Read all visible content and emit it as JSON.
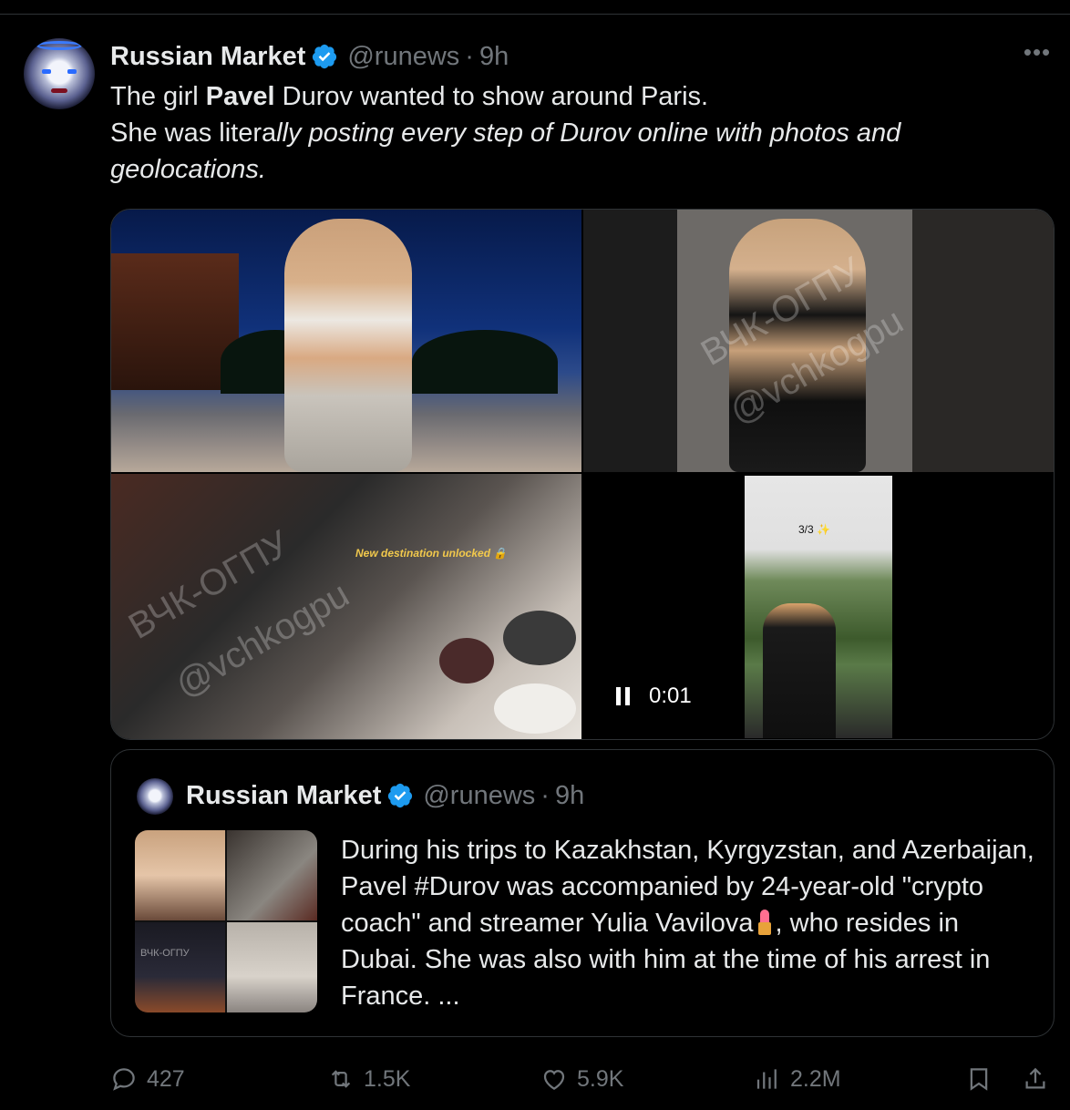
{
  "tweet": {
    "author_name": "Russian Market",
    "handle": "@runews",
    "time": "9h",
    "more_label": "•••",
    "text": {
      "line1_pre": "The girl ",
      "line1_bold": "Pavel",
      "line1_post": " Durov wanted to show around Paris.",
      "line2_plain": "She was litera",
      "line2_italic": "lly posting every step of Durov online with photos and",
      "line3_italic": "geolocations."
    },
    "media": {
      "overlay_text": "New destination unlocked 🔒",
      "story_counter": "3/3 ✨",
      "video_time": "0:01",
      "watermark_1": "ВЧК-ОГПУ",
      "watermark_2": "@vchkogpu"
    }
  },
  "quote": {
    "author_name": "Russian Market",
    "handle": "@runews",
    "time": "9h",
    "text_part1": "During his trips to Kazakhstan, Kyrgyzstan, and Azerbaijan, Pavel #Durov was accompanied by 24-year-old \"crypto coach\" and streamer Yulia Vavilova",
    "text_part2": ", who resides in Dubai. She was also with him at the time of his arrest in France. ...",
    "thumb_watermark": "ВЧК-ОГПУ"
  },
  "actions": {
    "replies": "427",
    "reposts": "1.5K",
    "likes": "5.9K",
    "views": "2.2M"
  },
  "icons": [
    "verified-badge-icon",
    "more-icon",
    "pause-icon",
    "reply-icon",
    "repost-icon",
    "like-icon",
    "views-icon",
    "bookmark-icon",
    "share-icon"
  ],
  "colors": {
    "background": "#000000",
    "text": "#e7e9ea",
    "secondary": "#71767b",
    "verified": "#1d9bf0",
    "border": "#2f3336"
  }
}
